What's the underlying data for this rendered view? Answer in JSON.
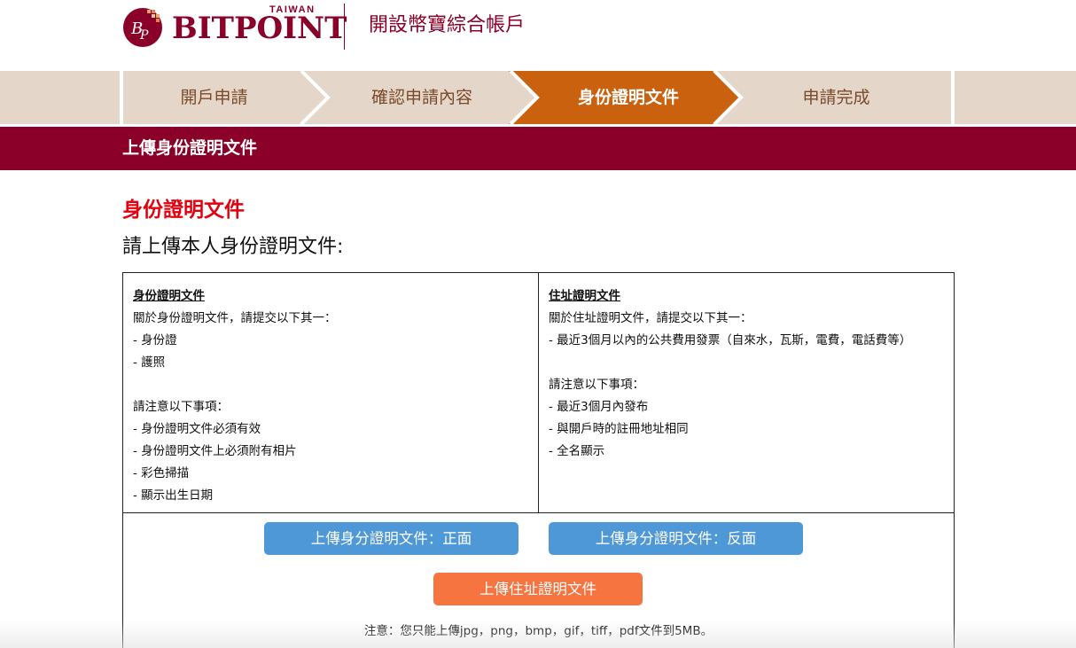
{
  "brand": {
    "logo_text": "BITPOINT",
    "logo_tag": "TAIWAN",
    "logo_monogram": "BP",
    "colors": {
      "primary": "#8b0028",
      "step_bg": "#e5d6ca",
      "step_active": "#c9610f",
      "alert_red": "#e3000f",
      "button_blue": "#4f98d8",
      "button_orange": "#f57440"
    }
  },
  "header": {
    "title": "開設幣寶綜合帳戶"
  },
  "steps": [
    {
      "label": "開戶申請",
      "active": false
    },
    {
      "label": "確認申請內容",
      "active": false
    },
    {
      "label": "身份證明文件",
      "active": true
    },
    {
      "label": "申請完成",
      "active": false
    }
  ],
  "section": {
    "title": "上傳身份證明文件"
  },
  "page": {
    "title": "身份證明文件",
    "subtitle": "請上傳本人身份證明文件:"
  },
  "identity": {
    "heading": "身份證明文件",
    "intro": "關於身份證明文件，請提交以下其一：",
    "options": [
      "- 身份證",
      "- 護照"
    ],
    "notes_heading": "請注意以下事項：",
    "notes": [
      "- 身份證明文件必須有效",
      "- 身份證明文件上必須附有相片",
      "- 彩色掃描",
      "- 顯示出生日期"
    ]
  },
  "address": {
    "heading": "住址證明文件",
    "intro": "關於住址證明文件，請提交以下其一：",
    "options": [
      "- 最近3個月以內的公共費用發票（自來水，瓦斯，電費，電話費等）"
    ],
    "notes_heading": "請注意以下事項：",
    "notes": [
      "- 最近3個月內發布",
      "- 與開戶時的註冊地址相同",
      "- 全名顯示"
    ]
  },
  "buttons": {
    "upload_id_front": "上傳身分證明文件：正面",
    "upload_id_back": "上傳身分證明文件：反面",
    "upload_address": "上傳住址證明文件"
  },
  "note": "注意：您只能上傳jpg，png，bmp，gif，tiff，pdf文件到5MB。"
}
